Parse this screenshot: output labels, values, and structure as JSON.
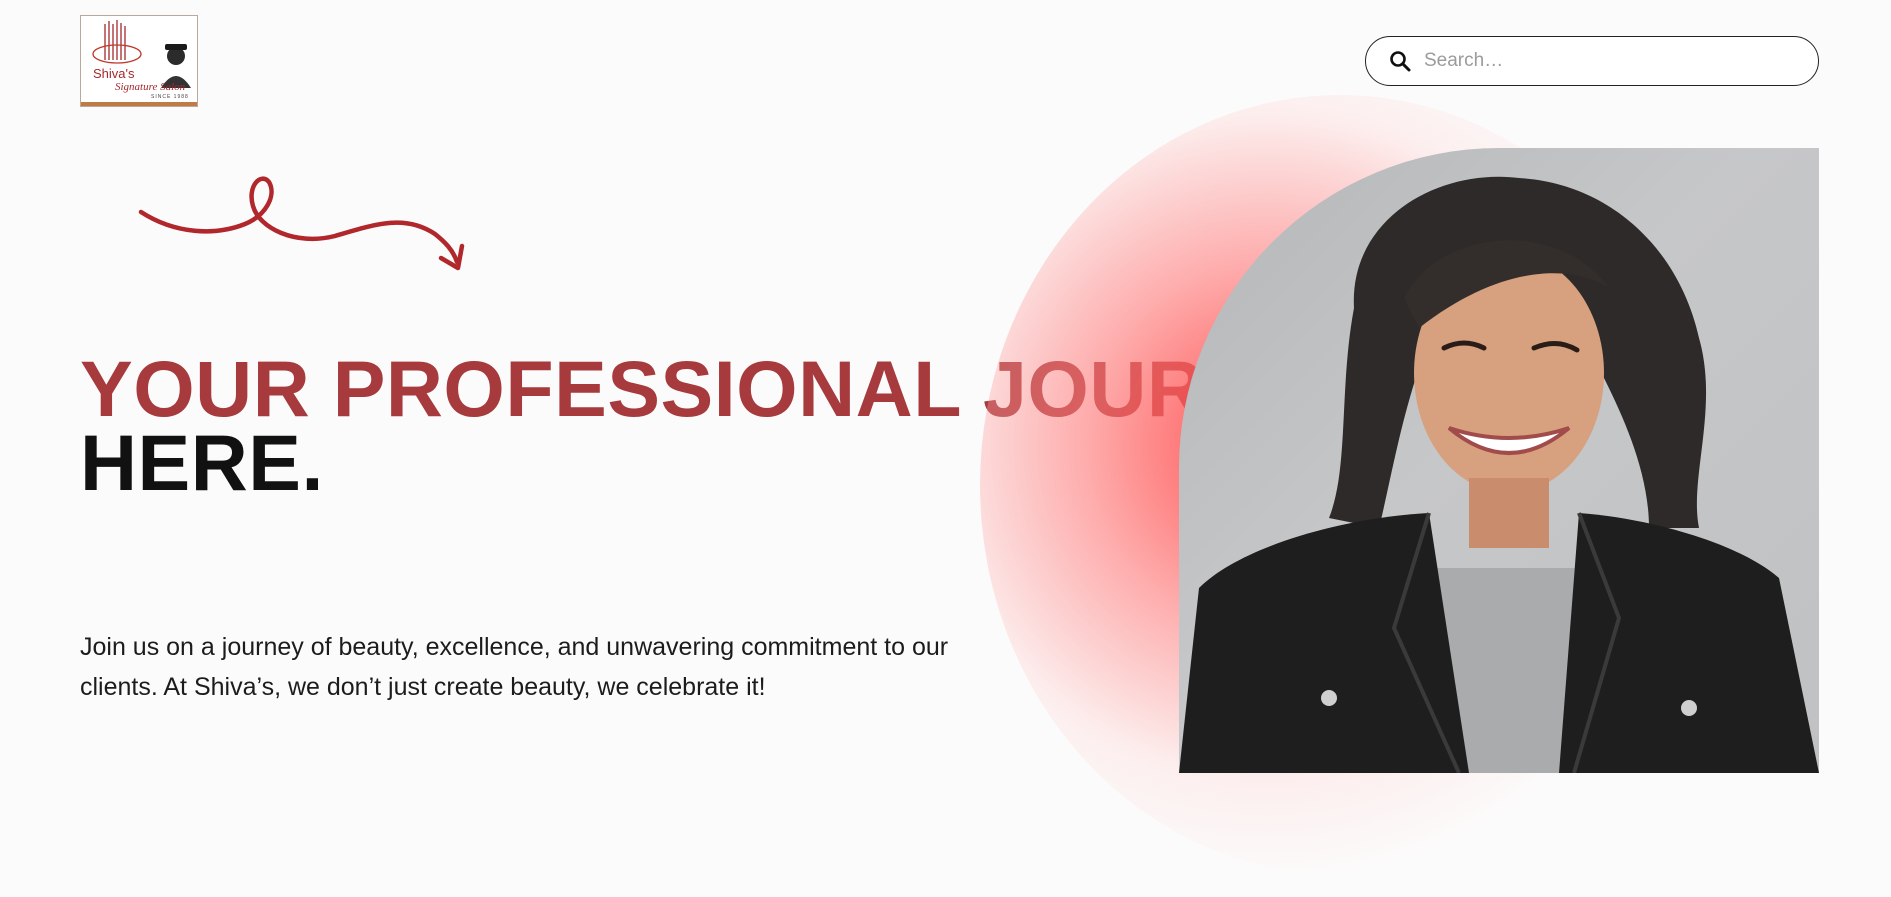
{
  "header": {
    "logo": {
      "line1": "Shiva's",
      "line2": "Signature Salon",
      "line3": "SINCE 1988",
      "accent_color": "#a5282d"
    },
    "search": {
      "placeholder": "Search…",
      "icon": "search-icon"
    }
  },
  "hero": {
    "decor": "swirl-arrow-icon",
    "headline_red": "YOUR PROFESSIONAL JOURNEY BEGINS",
    "headline_black": "HERE.",
    "headline_color": "#a63a3c",
    "paragraph": "Join us on a journey of beauty, excellence, and unwavering commitment to our clients. At Shiva’s, we don’t just create beauty, we celebrate it!",
    "image": "smiling-woman-portrait",
    "glow_color": "#ff4a4a"
  }
}
